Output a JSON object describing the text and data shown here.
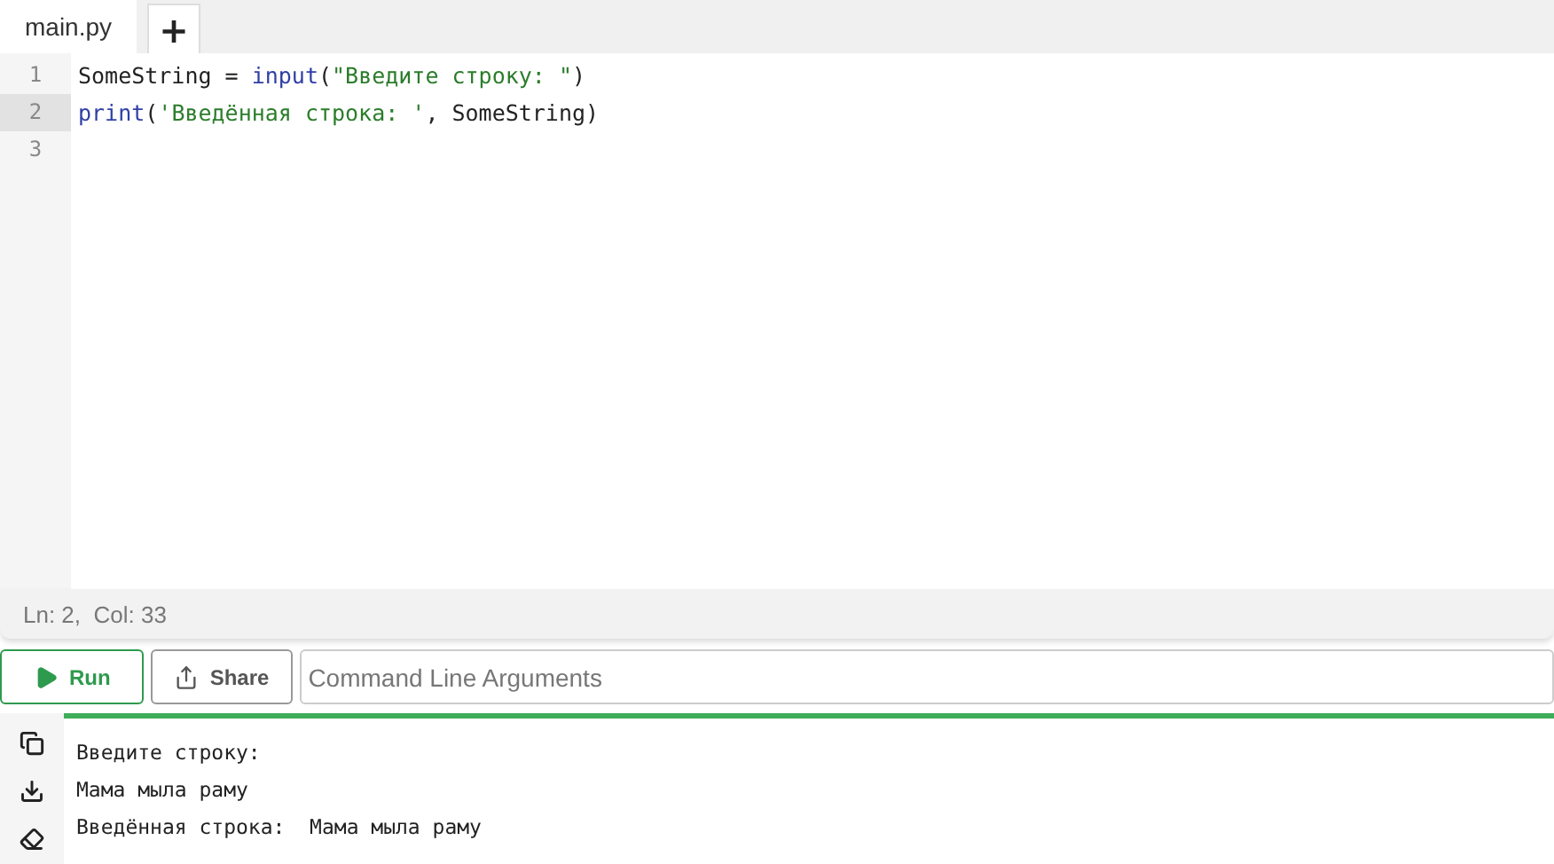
{
  "tabs": [
    {
      "label": "main.py",
      "selected": true
    }
  ],
  "add_tab": {
    "label": "+"
  },
  "editor": {
    "lines": [
      {
        "number": "1",
        "active": false,
        "tokens": [
          {
            "kind": "name",
            "text": "SomeString"
          },
          {
            "kind": "op",
            "text": " = "
          },
          {
            "kind": "builtin",
            "text": "input"
          },
          {
            "kind": "op",
            "text": "("
          },
          {
            "kind": "string",
            "text": "\"Введите строку: \""
          },
          {
            "kind": "op",
            "text": ")"
          }
        ]
      },
      {
        "number": "2",
        "active": true,
        "tokens": [
          {
            "kind": "builtin",
            "text": "print"
          },
          {
            "kind": "op",
            "text": "("
          },
          {
            "kind": "string",
            "text": "'Введённая строка: '"
          },
          {
            "kind": "op",
            "text": ", "
          },
          {
            "kind": "name",
            "text": "SomeString"
          },
          {
            "kind": "op",
            "text": ")"
          }
        ]
      },
      {
        "number": "3",
        "active": false
      }
    ]
  },
  "status_bar": "Ln: 2,  Col: 33",
  "toolbar": {
    "run": "Run",
    "share": "Share",
    "arguments": {
      "placeholder": "Command Line Arguments"
    }
  },
  "output": [
    "Введите строку:",
    "Мама мыла раму",
    "Введённая строка:  Мама мыла раму"
  ]
}
